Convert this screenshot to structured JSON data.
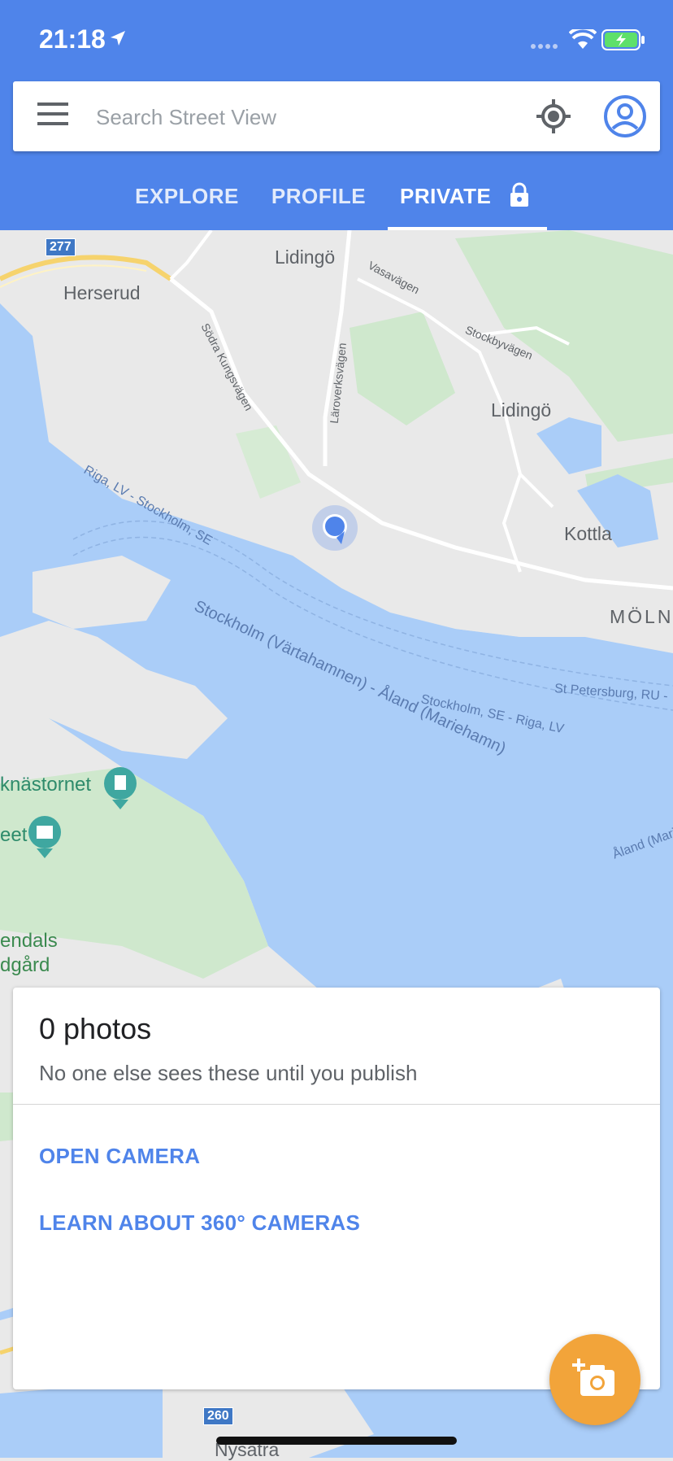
{
  "status": {
    "time": "21:18"
  },
  "search": {
    "placeholder": "Search Street View"
  },
  "tabs": [
    {
      "label": "EXPLORE"
    },
    {
      "label": "PROFILE"
    },
    {
      "label": "PRIVATE",
      "active": true
    }
  ],
  "map": {
    "places": {
      "lidingo_top": "Lidingö",
      "herserud": "Herserud",
      "lidingo_right": "Lidingö",
      "kottla": "Kottla",
      "molnd": "MÖLN",
      "nysatra": "Nysätra"
    },
    "roads": {
      "vasavagen": "Vasavägen",
      "stockbyvagen": "Stockbyvägen",
      "sodra_kungsvagen": "Södra Kungsvägen",
      "larovarksvagen": "Läroverksvägen",
      "road_277": "277",
      "road_260": "260"
    },
    "ferries": {
      "riga_stockholm": "Riga, LV - Stockholm, SE",
      "stockholm_aland": "Stockholm (Värtahamnen) - Åland (Mariehamn)",
      "st_petersburg": "St Petersburg, RU -",
      "stockholm_riga": "Stockholm, SE - Riga, LV",
      "aland_edge": "Åland (Mari"
    },
    "pois": {
      "tower": "knästornet",
      "museum": "eet",
      "park1": "endals",
      "park2": "dgård"
    }
  },
  "sheet": {
    "title": "0 photos",
    "subtitle": "No one else sees these until you publish",
    "open_camera": "OPEN CAMERA",
    "learn_360": "LEARN ABOUT 360° CAMERAS"
  },
  "colors": {
    "appbar": "#4f84ea",
    "accent": "#4f84ea",
    "fab": "#f2a43a",
    "water": "#aacdf8",
    "land": "#e9e9e9",
    "park": "#cfe8cd"
  },
  "icons": [
    "menu-icon",
    "my-location-icon",
    "account-icon",
    "lock-icon",
    "add-photo-icon"
  ]
}
